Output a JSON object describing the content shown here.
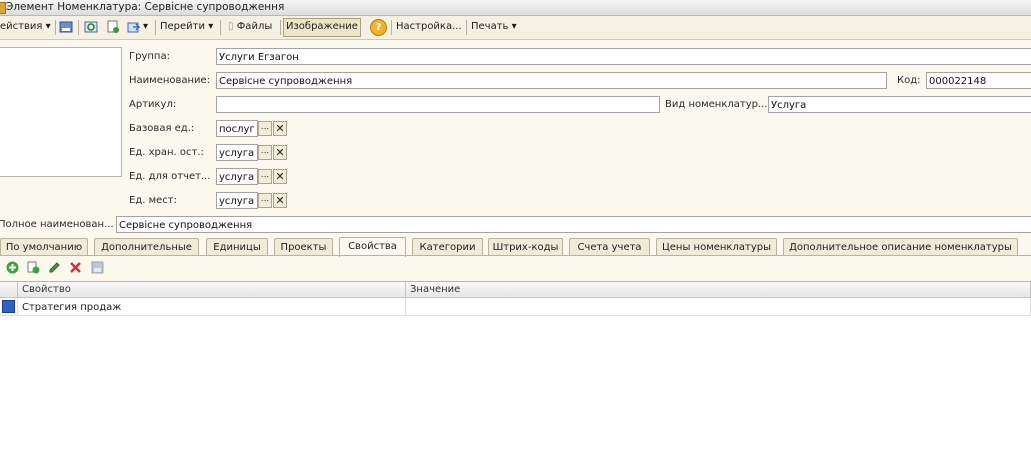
{
  "window": {
    "title": "Элемент Номенклатура: Сервісне супроводження"
  },
  "toolbar": {
    "actions_label": "ействия",
    "goto_label": "Перейти",
    "files_label": "Файлы",
    "image_label": "Изображение",
    "help_label": "?",
    "settings_label": "Настройка...",
    "print_label": "Печать"
  },
  "form": {
    "group_label": "Группа:",
    "group_value": "Услуги Егзагон",
    "name_label": "Наименование:",
    "name_value": "Сервісне супроводження",
    "code_label": "Код:",
    "code_value": "000022148",
    "article_label": "Артикул:",
    "article_value": "",
    "kind_label": "Вид номенклатур...",
    "kind_value": "Услуга",
    "base_unit_label": "Базовая ед.:",
    "base_unit_value": "послуг",
    "storage_unit_label": "Ед. хран. ост.:",
    "storage_unit_value": "услуга",
    "report_unit_label": "Ед. для отчет...",
    "report_unit_value": "услуга",
    "place_unit_label": "Ед. мест:",
    "place_unit_value": "услуга",
    "full_name_label": "Полное наименован...",
    "full_name_value": "Сервісне супроводження",
    "dots": "...",
    "clear": "✕"
  },
  "tabs": [
    {
      "label": "По умолчанию"
    },
    {
      "label": "Дополнительные"
    },
    {
      "label": "Единицы"
    },
    {
      "label": "Проекты"
    },
    {
      "label": "Свойства"
    },
    {
      "label": "Категории"
    },
    {
      "label": "Штрих-коды"
    },
    {
      "label": "Счета учета"
    },
    {
      "label": "Цены номенклатуры"
    },
    {
      "label": "Дополнительное описание номенклатуры"
    }
  ],
  "active_tab": "Свойства",
  "table": {
    "columns": [
      "Свойство",
      "Значение"
    ],
    "rows": [
      {
        "property": "Стратегия продаж",
        "value": ""
      }
    ]
  },
  "colors": {
    "accent": "#2f62c8",
    "background": "#fbf9ee"
  }
}
